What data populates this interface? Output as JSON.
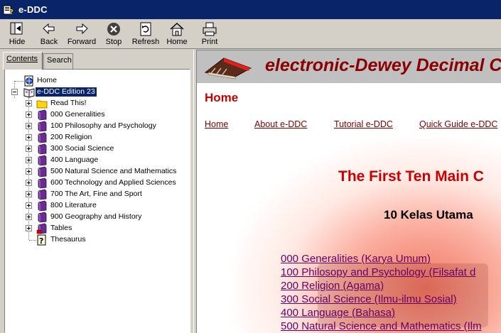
{
  "window": {
    "title": "e-DDC"
  },
  "toolbar": {
    "buttons": [
      {
        "label": "Hide",
        "icon": "hide-icon"
      },
      {
        "label": "Back",
        "icon": "back-arrow-icon"
      },
      {
        "label": "Forward",
        "icon": "forward-arrow-icon"
      },
      {
        "label": "Stop",
        "icon": "stop-icon"
      },
      {
        "label": "Refresh",
        "icon": "refresh-icon"
      },
      {
        "label": "Home",
        "icon": "home-icon"
      },
      {
        "label": "Print",
        "icon": "print-icon"
      }
    ]
  },
  "sidebar": {
    "tabs": [
      {
        "label": "Contents",
        "active": true
      },
      {
        "label": "Search",
        "active": false
      }
    ],
    "tree": {
      "home": "Home",
      "root": "e-DDC Edition 23",
      "items": [
        {
          "label": "Read This!",
          "icon": "folder-icon"
        },
        {
          "label": "000 Generalities",
          "icon": "book-icon"
        },
        {
          "label": "100 Philosophy and Psychology",
          "icon": "book-icon"
        },
        {
          "label": "200 Religion",
          "icon": "book-icon"
        },
        {
          "label": "300 Social Science",
          "icon": "book-icon"
        },
        {
          "label": "400 Language",
          "icon": "book-icon"
        },
        {
          "label": "500 Natural Science and Mathematics",
          "icon": "book-icon"
        },
        {
          "label": "600 Technology and Applied Sciences",
          "icon": "book-icon"
        },
        {
          "label": "700 The Art, Fine and Sport",
          "icon": "book-icon"
        },
        {
          "label": "800 Literature",
          "icon": "book-icon"
        },
        {
          "label": "900 Geography and History",
          "icon": "book-icon"
        },
        {
          "label": "Tables",
          "icon": "book-icon"
        },
        {
          "label": "Thesaurus",
          "icon": "help-page-icon"
        }
      ]
    }
  },
  "content": {
    "banner_title": "electronic-Dewey Decimal C",
    "heading": "Home",
    "nav_links": [
      "Home",
      "About e-DDC",
      "Tutorial e-DDC",
      "Quick Guide e-DDC"
    ],
    "main_title": "The First Ten Main C",
    "sub_title": "10 Kelas Utama",
    "classes": [
      "000 Generalities (Karya Umum)",
      "100 Philosopy and Psychology (Filsafat d",
      "200 Religion (Agama)",
      "300 Social Science (Ilmu-ilmu Sosial)",
      "400 Language (Bahasa)",
      "500 Natural Science and Mathematics (Ilm"
    ],
    "colors": {
      "heading": "#cc0000",
      "link": "#800000",
      "class_link": "#660066",
      "title_bar": "#0a246a"
    }
  }
}
